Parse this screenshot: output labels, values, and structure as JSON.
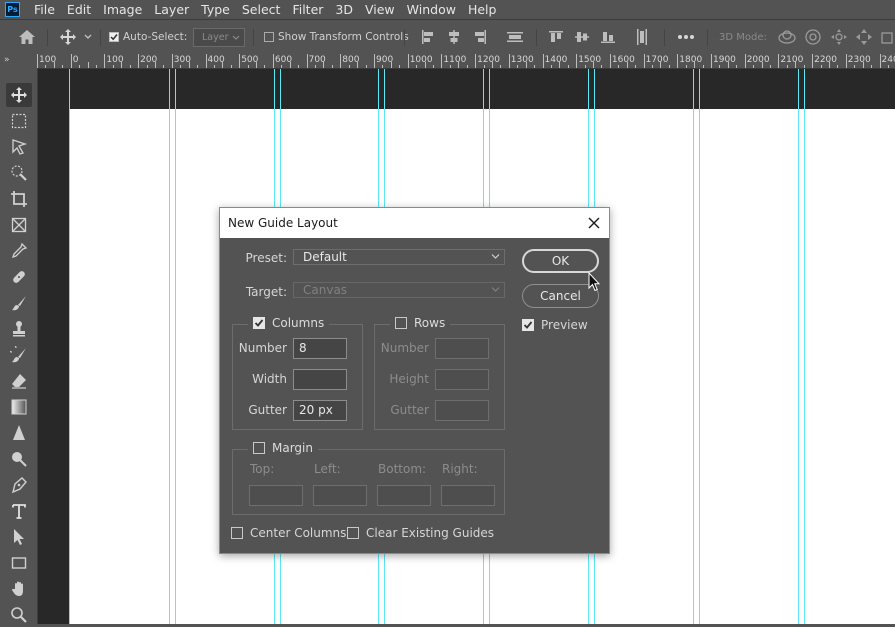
{
  "app": {
    "logo_text": "Ps",
    "menu": [
      "File",
      "Edit",
      "Image",
      "Layer",
      "Type",
      "Select",
      "Filter",
      "3D",
      "View",
      "Window",
      "Help"
    ]
  },
  "options_bar": {
    "auto_select_label": "Auto-Select:",
    "auto_select_checked": true,
    "layer_select_value": "Layer",
    "show_transform_label": "Show Transform Controls",
    "show_transform_checked": false,
    "three_d_mode_label": "3D Mode:"
  },
  "ruler": {
    "corner_label": "»",
    "labels": [
      "100",
      "0",
      "100",
      "200",
      "300",
      "400",
      "500",
      "600",
      "700",
      "800",
      "900",
      "1000",
      "1100",
      "1200",
      "1300",
      "1400",
      "1500",
      "1600",
      "1700",
      "1800",
      "1900",
      "2000",
      "2100",
      "2200",
      "2300",
      "2400"
    ]
  },
  "toolbar": {
    "tools": [
      "move-tool",
      "rectangular-marquee-tool",
      "lasso-tool",
      "quick-selection-tool",
      "crop-tool",
      "frame-tool",
      "eyedropper-tool",
      "healing-brush-tool",
      "brush-tool",
      "clone-stamp-tool",
      "history-brush-tool",
      "eraser-tool",
      "gradient-tool",
      "blur-tool",
      "dodge-tool",
      "pen-tool",
      "type-tool",
      "path-selection-tool",
      "rectangle-tool",
      "hand-tool",
      "zoom-tool"
    ],
    "active_tool": "move-tool"
  },
  "dialog": {
    "title": "New Guide Layout",
    "preset_label": "Preset:",
    "preset_value": "Default",
    "target_label": "Target:",
    "target_value": "Canvas",
    "columns": {
      "label": "Columns",
      "checked": true,
      "number_label": "Number",
      "number_value": "8",
      "width_label": "Width",
      "width_value": "",
      "gutter_label": "Gutter",
      "gutter_value": "20 px"
    },
    "rows": {
      "label": "Rows",
      "checked": false,
      "number_label": "Number",
      "number_value": "",
      "height_label": "Height",
      "height_value": "",
      "gutter_label": "Gutter",
      "gutter_value": ""
    },
    "margin": {
      "label": "Margin",
      "checked": false,
      "top_label": "Top:",
      "left_label": "Left:",
      "bottom_label": "Bottom:",
      "right_label": "Right:",
      "top_value": "",
      "left_value": "",
      "bottom_value": "",
      "right_value": ""
    },
    "center_columns_label": "Center Columns",
    "center_columns_checked": false,
    "clear_guides_label": "Clear Existing Guides",
    "clear_guides_checked": false,
    "ok_label": "OK",
    "cancel_label": "Cancel",
    "preview_label": "Preview",
    "preview_checked": true
  },
  "colors": {
    "ui_gray": "#535353",
    "canvas_bg": "#282828",
    "guide_cyan": "#5ee7f5",
    "document_white": "#ffffff"
  }
}
